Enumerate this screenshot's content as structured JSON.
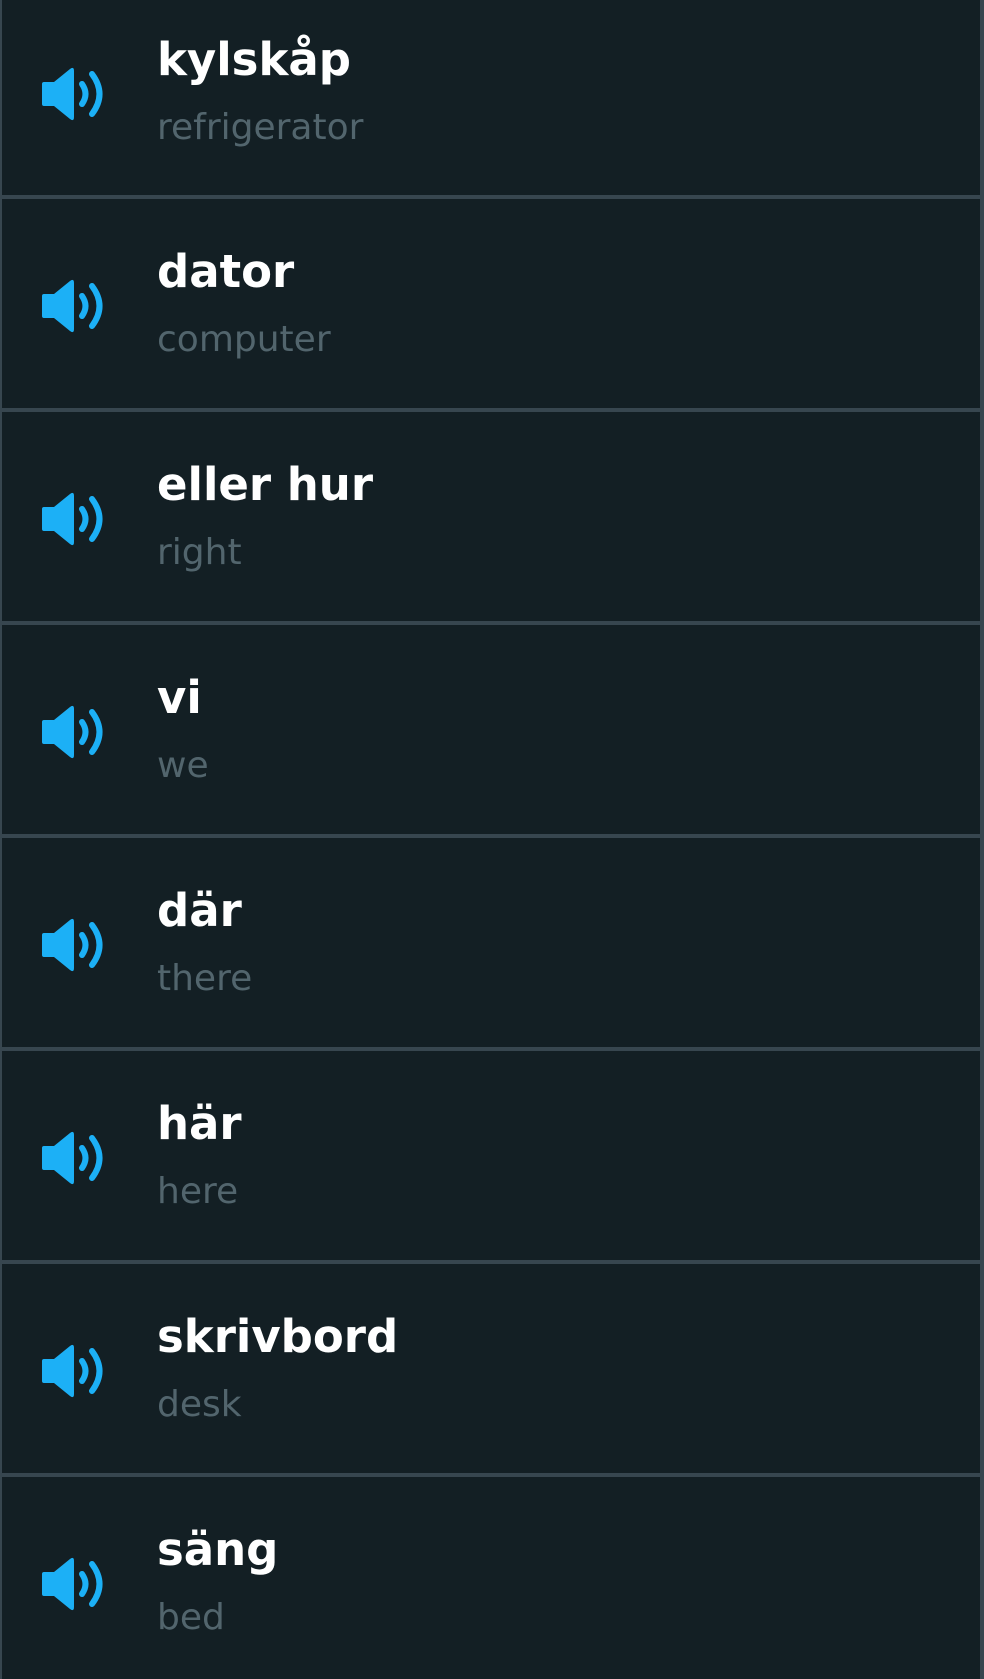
{
  "colors": {
    "background": "#131f24",
    "divider": "#37464f",
    "accent": "#1cb0f6",
    "word_text": "#ffffff",
    "translation_text": "#52656d"
  },
  "icon": "speaker-icon",
  "vocabulary": [
    {
      "word": "kylskåp",
      "translation": "refrigerator"
    },
    {
      "word": "dator",
      "translation": "computer"
    },
    {
      "word": "eller hur",
      "translation": "right"
    },
    {
      "word": "vi",
      "translation": "we"
    },
    {
      "word": "där",
      "translation": "there"
    },
    {
      "word": "här",
      "translation": "here"
    },
    {
      "word": "skrivbord",
      "translation": "desk"
    },
    {
      "word": "säng",
      "translation": "bed"
    }
  ]
}
